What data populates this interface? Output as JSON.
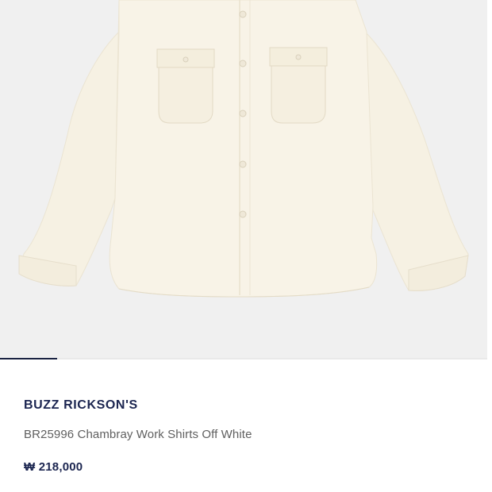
{
  "product": {
    "brand": "BUZZ RICKSON'S",
    "name": "BR25996 Chambray Work Shirts Off White",
    "price": "₩ 218,000",
    "image_description_icon": "off-white-shirt-photo"
  },
  "gallery": {
    "current_index": 1,
    "total": 9
  },
  "colors": {
    "accent": "#1b2550",
    "image_background": "#f0f0f0",
    "shirt": "#f7f2e6"
  }
}
